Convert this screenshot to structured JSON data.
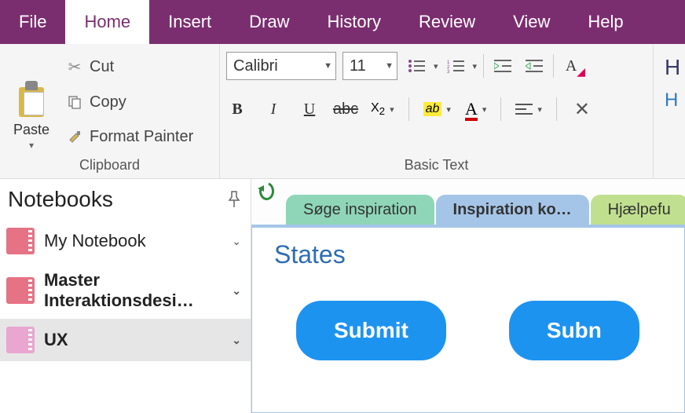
{
  "menu": {
    "tabs": [
      "File",
      "Home",
      "Insert",
      "Draw",
      "History",
      "Review",
      "View",
      "Help"
    ],
    "active": 1
  },
  "ribbon": {
    "clipboard": {
      "label": "Clipboard",
      "paste": "Paste",
      "cut": "Cut",
      "copy": "Copy",
      "format_painter": "Format Painter"
    },
    "basic_text": {
      "label": "Basic Text",
      "font": "Calibri",
      "size": "11"
    }
  },
  "sidebar": {
    "title": "Notebooks",
    "items": [
      {
        "label": "My Notebook",
        "color": "red",
        "bold": false,
        "active": false
      },
      {
        "label": "Master Interaktionsdesi…",
        "color": "red",
        "bold": true,
        "active": false
      },
      {
        "label": "UX",
        "color": "pink",
        "bold": true,
        "active": true
      }
    ]
  },
  "page_tabs": [
    {
      "label": "Søge inspiration",
      "style": "green",
      "active": false
    },
    {
      "label": "Inspiration ko…",
      "style": "blue",
      "active": true
    },
    {
      "label": "Hjælpefu",
      "style": "lime",
      "active": false
    }
  ],
  "page": {
    "title": "States",
    "buttons": [
      "Submit",
      "Subn"
    ]
  },
  "headings_preview": {
    "h1": "H",
    "h2": "H"
  }
}
